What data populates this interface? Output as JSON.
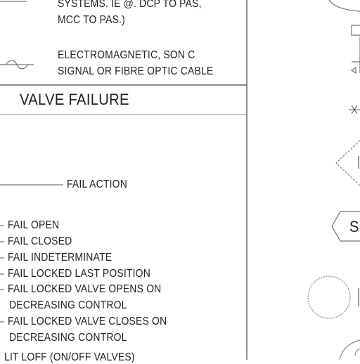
{
  "legend": {
    "systems_line": "SYSTEMS. IE @. DCP TO PAS,",
    "mcc_line": "MCC TO PAS.)",
    "em_line1": "ELECTROMAGNETIC, SON C",
    "em_line2": "SIGNAL OR FIBRE OPTIC CABLE"
  },
  "valve_failure": {
    "title": "VALVE FAILURE",
    "fail_action_label": "FAIL ACTION",
    "items": [
      "FAIL OPEN",
      "FAIL CLOSED",
      "FAIL INDETERMINATE",
      "FAIL LOCKED LAST POSITION",
      "FAIL LOCKED VALVE OPENS ON",
      "DECREASING CONTROL",
      "FAIL LOCKED VALVE CLOSES ON",
      "DECREASING CONTROL",
      "LIT LOFF (ON/OFF VALVES)"
    ]
  },
  "right_symbols": {
    "s_label": "S"
  }
}
